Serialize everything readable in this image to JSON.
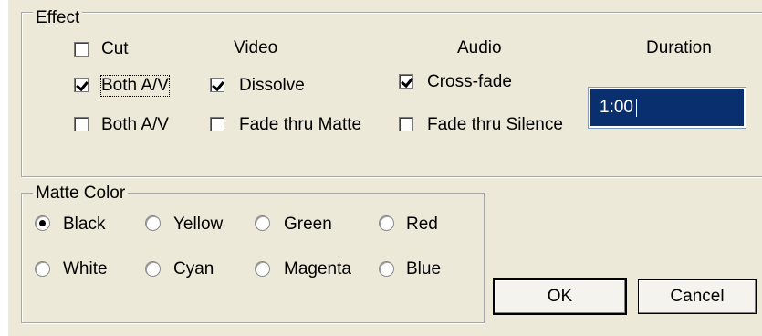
{
  "effect": {
    "legend": "Effect",
    "headers": {
      "video": "Video",
      "audio": "Audio",
      "duration": "Duration"
    },
    "cut": {
      "label": "Cut",
      "checked": false
    },
    "both_av_1": {
      "label": "Both A/V",
      "checked": true
    },
    "both_av_2": {
      "label": "Both A/V",
      "checked": false
    },
    "dissolve": {
      "label": "Dissolve",
      "checked": true
    },
    "fade_thru_matte": {
      "label": "Fade thru Matte",
      "checked": false
    },
    "cross_fade": {
      "label": "Cross-fade",
      "checked": true
    },
    "fade_thru_silence": {
      "label": "Fade thru Silence",
      "checked": false
    },
    "duration_value": "1:00"
  },
  "matte_color": {
    "legend": "Matte Color",
    "selected": "Black",
    "options": [
      "Black",
      "Yellow",
      "Green",
      "Red",
      "White",
      "Cyan",
      "Magenta",
      "Blue"
    ]
  },
  "buttons": {
    "ok": "OK",
    "cancel": "Cancel"
  },
  "colors": {
    "dialog_bg": "#ece9d8",
    "selection": "#0a2f6e"
  }
}
